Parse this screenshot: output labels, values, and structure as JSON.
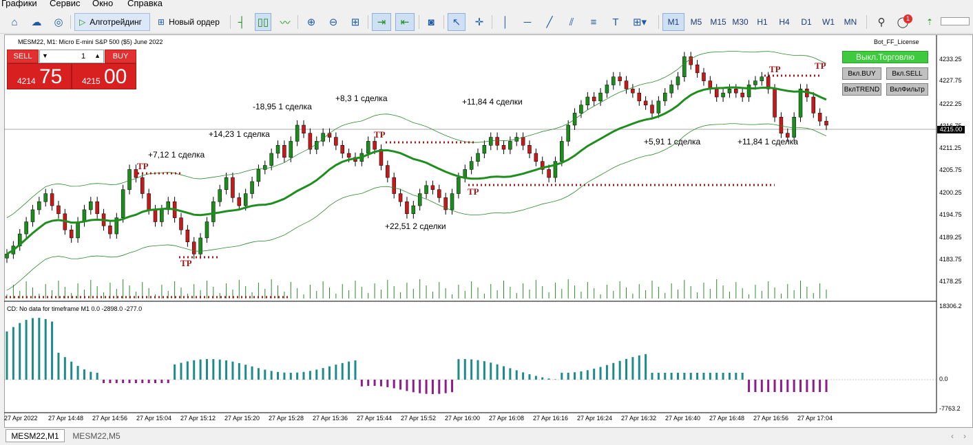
{
  "menu": [
    "Графики",
    "Сервис",
    "Окно",
    "Справка"
  ],
  "toolbar": {
    "algo_label": "Алготрейдинг",
    "new_order_label": "Новый ордер",
    "timeframes": [
      "M1",
      "M5",
      "M15",
      "M30",
      "H1",
      "H4",
      "D1",
      "W1",
      "MN"
    ],
    "active_timeframe": "M1",
    "notification_count": "1"
  },
  "chart": {
    "title": "MESM22, M1:  Micro E-mini S&P 500 ($5) June 2022",
    "license": "Bot_FF_License",
    "sell_label": "SELL",
    "buy_label": "BUY",
    "lot": "1",
    "sell_small": "4214",
    "sell_big": "75",
    "buy_small": "4215",
    "buy_big": "00",
    "current_price": "4215.00",
    "price_axis": [
      "4233.25",
      "4227.75",
      "4222.25",
      "4216.75",
      "4211.25",
      "4205.75",
      "4200.25",
      "4194.75",
      "4189.25",
      "4183.75",
      "4178.25"
    ],
    "time_axis": [
      "27 Apr 2022",
      "27 Apr 14:48",
      "27 Apr 14:56",
      "27 Apr 15:04",
      "27 Apr 15:12",
      "27 Apr 15:20",
      "27 Apr 15:28",
      "27 Apr 15:36",
      "27 Apr 15:44",
      "27 Apr 15:52",
      "27 Apr 16:00",
      "27 Apr 16:08",
      "27 Apr 16:16",
      "27 Apr 16:24",
      "27 Apr 16:32",
      "27 Apr 16:40",
      "27 Apr 16:48",
      "27 Apr 16:56",
      "27 Apr 17:04"
    ],
    "annotations": [
      "+7,12  1 сделка",
      "+14,23  1 сделка",
      "-18,95  1 сделка",
      "+8,3  1 сделка",
      "+11,84  4 сделки",
      "+22,51  2 сделки",
      "+5,91  1 сделка",
      "+11,84  1 сделка"
    ],
    "tp_label": "TP",
    "indicator_label": "CD: No data for timeframe M1 0.0 -2898.0 -277.0",
    "indicator_axis": [
      "18306.2",
      "0.0",
      "-7763.2"
    ]
  },
  "bot_panel": {
    "trade_toggle": "Выкл.Торговлю",
    "buy_btn": "Вкл.BUY",
    "sell_btn": "Вкл.SELL",
    "trend_btn": "ВклTREND",
    "filter_btn": "ВклФильтр"
  },
  "tabs": [
    "MESM22,M1",
    "MESM22,M5"
  ],
  "colors": {
    "bull": "#1c8c1c",
    "bear": "#c41a1a",
    "ma": "#1e8e1e",
    "hist_pos": "#1e8b8b",
    "hist_neg": "#8b1e8b"
  }
}
